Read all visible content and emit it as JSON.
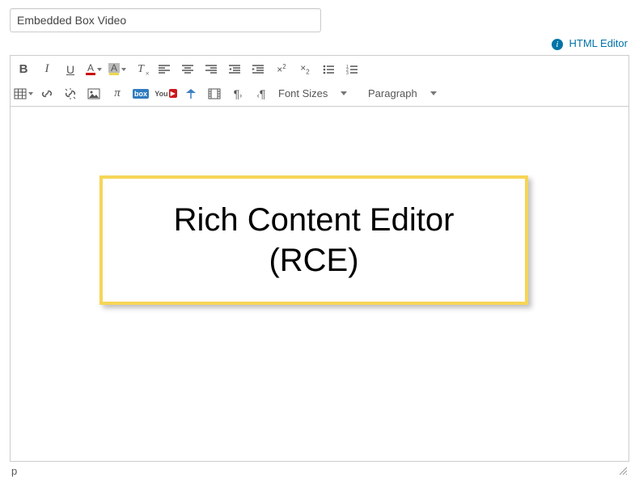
{
  "title_input": {
    "value": "Embedded Box Video"
  },
  "switch_link": {
    "label": "HTML Editor"
  },
  "toolbar": {
    "font_sizes_label": "Font Sizes",
    "paragraph_label": "Paragraph"
  },
  "callout": {
    "line1": "Rich Content Editor",
    "line2": "(RCE)"
  },
  "status": {
    "path": "p"
  }
}
